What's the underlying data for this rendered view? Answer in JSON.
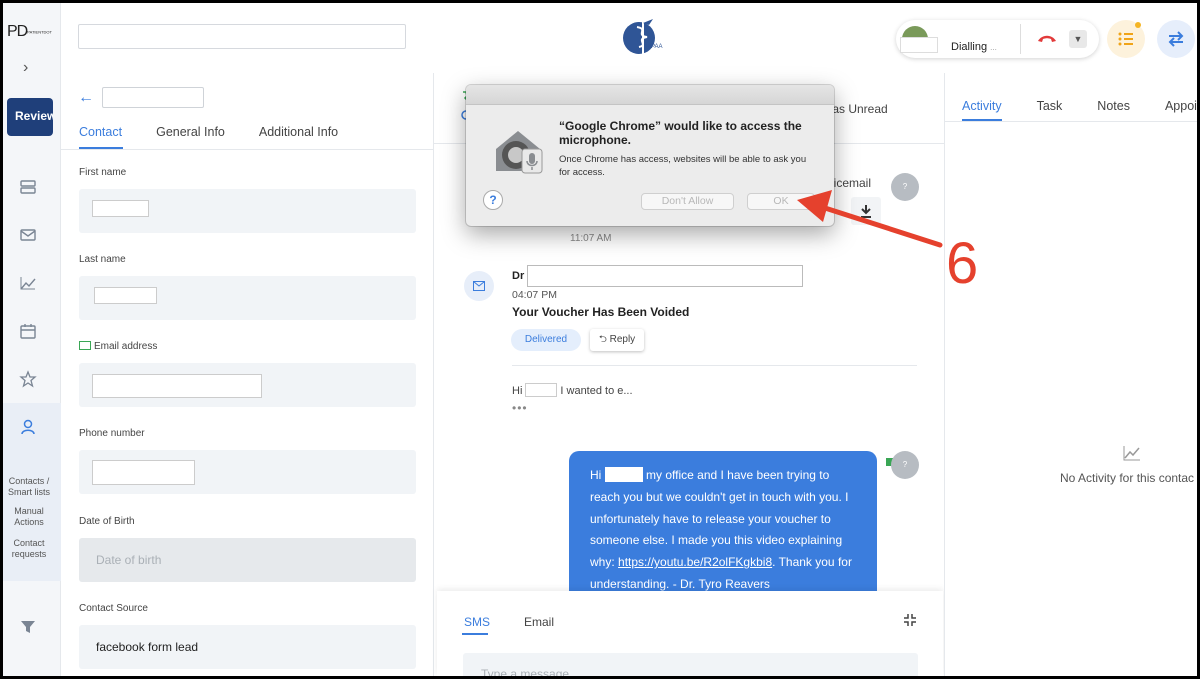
{
  "rail": {
    "logo": "PD",
    "logo_small": "PATIENTDOT",
    "review_label": "Review",
    "sub_items": [
      "Contacts /\nSmart lists",
      "Manual\nActions",
      "Contact\nrequests"
    ]
  },
  "topbar": {
    "logo_text": "HIPAA",
    "call_status": "Dialling"
  },
  "contact": {
    "tabs": [
      "Contact",
      "General Info",
      "Additional Info"
    ],
    "fields": {
      "first_name": "First name",
      "last_name": "Last name",
      "email": "Email address",
      "phone": "Phone number",
      "dob": "Date of Birth",
      "dob_placeholder": "Date of birth",
      "source": "Contact Source",
      "source_value": "facebook form lead"
    }
  },
  "convo": {
    "mark_unread": "rk as Unread",
    "voicemail": "oicemail",
    "time1": "11:07 AM",
    "email_from": "Dr",
    "time2": "04:07 PM",
    "subject": "Your Voucher Has Been Voided",
    "delivered": "Delivered",
    "reply": "Reply",
    "preview_pre": "Hi",
    "preview_post": "I wanted to e...",
    "more": "•••",
    "bubble_pre": "Hi",
    "bubble_post": "my office and I have been trying to reach you but we couldn't get in touch with you. I unfortunately have to release your voucher to someone else. I made you this video explaining why:",
    "bubble_link": "https://youtu.be/R2olFKgkbi8",
    "bubble_end": ". Thank you for understanding. - Dr. Tyro Reavers",
    "avatar_q": "?",
    "composer_tabs": [
      "SMS",
      "Email"
    ],
    "composer_placeholder": "Type a message"
  },
  "right": {
    "tabs": [
      "Activity",
      "Task",
      "Notes",
      "Appoi"
    ],
    "empty": "No Activity for this contac"
  },
  "dialog": {
    "title": "“Google Chrome” would like to access the microphone.",
    "message": "Once Chrome has access, websites will be able to ask you for access.",
    "help": "?",
    "deny": "Don't Allow",
    "ok": "OK"
  },
  "annotation": {
    "step": "6",
    "color": "#e5412d"
  },
  "colors": {
    "accent": "#3b7ddd",
    "rail_button": "#1f3f7a"
  }
}
